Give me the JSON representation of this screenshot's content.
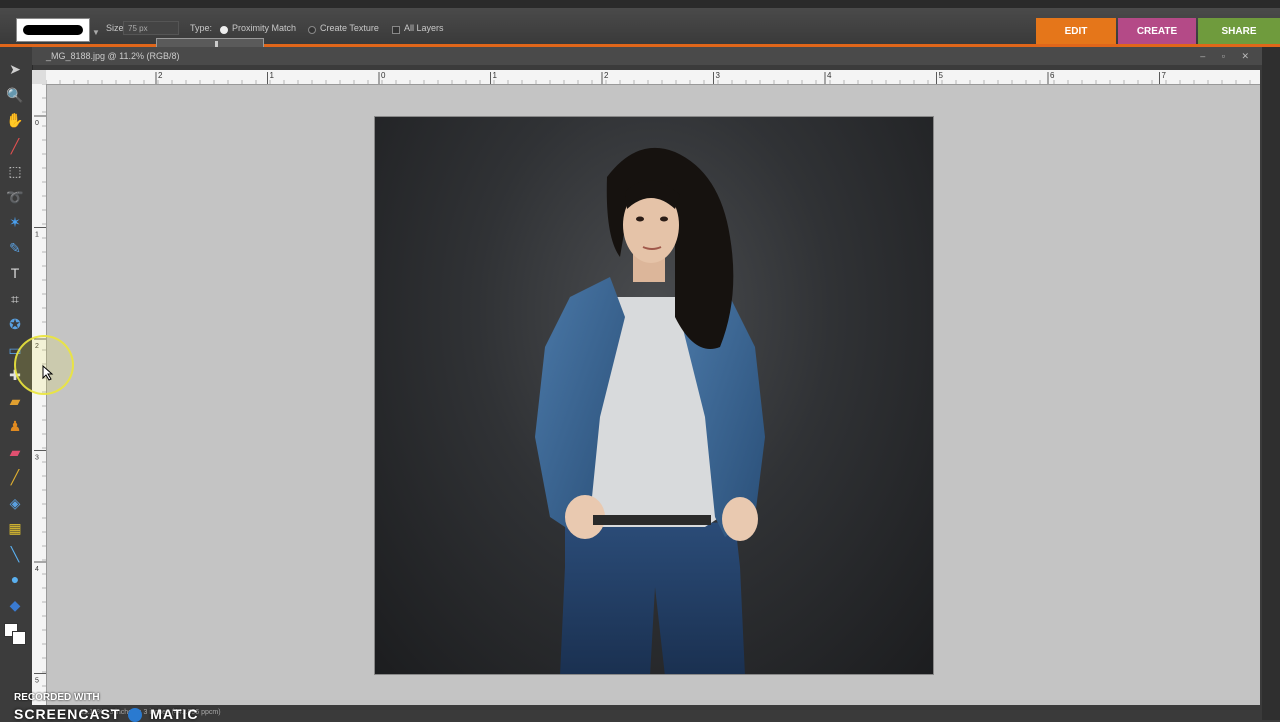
{
  "options_bar": {
    "size_label": "Size:",
    "size_value": "75 px",
    "type_label": "Type:",
    "type_options": [
      "Proximity Match",
      "Create Texture"
    ],
    "type_selected": "Proximity Match",
    "all_layers_label": "All Layers"
  },
  "mode_tabs": [
    {
      "label": "EDIT",
      "color": "#e5761a"
    },
    {
      "label": "CREATE",
      "color": "#b44a87"
    },
    {
      "label": "SHARE",
      "color": "#6f9b3d"
    }
  ],
  "document": {
    "tab_title": "_MG_8188.jpg @ 11.2% (RGB/8)",
    "status_text": "11.16% · 3 inches × 3 inches (441.896 ppcm)"
  },
  "ruler": {
    "h_labels": [
      "2",
      "1",
      "0",
      "1",
      "2",
      "3",
      "4",
      "5",
      "6",
      "7"
    ],
    "v_labels": [
      "0",
      "1",
      "2",
      "3",
      "4",
      "5"
    ]
  },
  "toolbox": {
    "tools": [
      {
        "name": "move-tool-icon",
        "glyph": "➤",
        "color": "#d0d0d0"
      },
      {
        "name": "zoom-tool-icon",
        "glyph": "🔍",
        "color": "#5aa0e0"
      },
      {
        "name": "hand-tool-icon",
        "glyph": "✋",
        "color": "#e0e0e0"
      },
      {
        "name": "eyedropper-tool-icon",
        "glyph": "╱",
        "color": "#e05050"
      },
      {
        "name": "marquee-tool-icon",
        "glyph": "⬚",
        "color": "#cfcfcf"
      },
      {
        "name": "lasso-tool-icon",
        "glyph": "➰",
        "color": "#d8a030"
      },
      {
        "name": "magic-wand-tool-icon",
        "glyph": "✶",
        "color": "#4aa0f0"
      },
      {
        "name": "quick-selection-tool-icon",
        "glyph": "✎",
        "color": "#5aa0e0"
      },
      {
        "name": "type-tool-icon",
        "glyph": "T",
        "color": "#d8d8d8"
      },
      {
        "name": "crop-tool-icon",
        "glyph": "⌗",
        "color": "#d8d8d8"
      },
      {
        "name": "cookie-cutter-tool-icon",
        "glyph": "✪",
        "color": "#5aa0e0"
      },
      {
        "name": "straighten-tool-icon",
        "glyph": "▭",
        "color": "#5aa0e0"
      },
      {
        "name": "red-eye-tool-icon",
        "glyph": "✚",
        "color": "#e0e0e0"
      },
      {
        "name": "spot-healing-tool-icon",
        "glyph": "▰",
        "color": "#e0a030"
      },
      {
        "name": "clone-stamp-tool-icon",
        "glyph": "♟",
        "color": "#e08a20"
      },
      {
        "name": "eraser-tool-icon",
        "glyph": "▰",
        "color": "#e05070"
      },
      {
        "name": "brush-tool-icon",
        "glyph": "╱",
        "color": "#e0b030"
      },
      {
        "name": "paint-bucket-tool-icon",
        "glyph": "◈",
        "color": "#5aa0e0"
      },
      {
        "name": "gradient-tool-icon",
        "glyph": "▦",
        "color": "#e0c030"
      },
      {
        "name": "line-tool-icon",
        "glyph": "╲",
        "color": "#5ab0f0"
      },
      {
        "name": "blur-tool-icon",
        "glyph": "●",
        "color": "#5ab0f0"
      },
      {
        "name": "sponge-tool-icon",
        "glyph": "◆",
        "color": "#3a7ad0"
      }
    ]
  },
  "watermark": {
    "top": "RECORDED WITH",
    "main": "SCREENCAST",
    "suffix": "MATIC"
  }
}
